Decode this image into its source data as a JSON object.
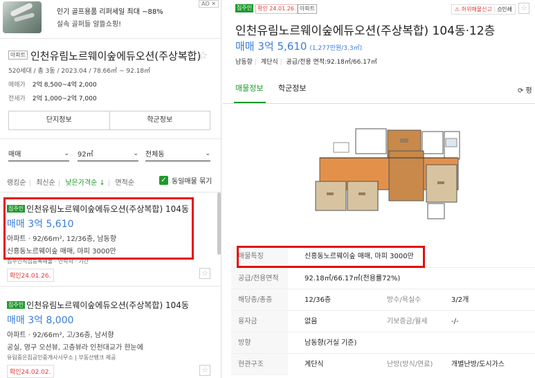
{
  "ad": {
    "title": "인기 골프용품 리퍼세일 최대 ~88%",
    "subtitle": "실속 골퍼들 알뜰쇼핑!",
    "badge": "AD ✕"
  },
  "complex": {
    "type_tag": "아파트",
    "name": "인천유림노르웨이숲에듀오션(주상복합)",
    "favorite_icon": "☆",
    "info": "520세대 / 총 3동 / 2023.04 / 78.66㎡ ~ 92.18㎡",
    "sale_label": "매매가",
    "sale_range": "2억 8,500~4억 2,000",
    "rent_label": "전세가",
    "rent_range": "2억 1,000~2억 7,000",
    "buttons": [
      "단지정보",
      "학군정보"
    ]
  },
  "filters": {
    "trade_type": "매매",
    "area": "92㎡",
    "building": "전체동",
    "chevron": "⌄"
  },
  "sort": {
    "options": [
      "랭킹순",
      "최신순",
      "낮은가격순 ↓",
      "면적순"
    ],
    "active_index": 2,
    "same_listing_label": "동일매물 묶기",
    "same_listing_checked": true
  },
  "listings": [
    {
      "badge": "집주인",
      "title": "인천유림노르웨이숲에듀오션(주상복합) 104동",
      "price": "매매 3억 5,610",
      "spec": "아파트 · 92/66m², 12/36층, 남동향",
      "desc": "신흥동노르웨이숲 매매, 마피 3000만",
      "agent": "집주인직접등록매물 · 연락처 · 기간",
      "confirm": "확인24.01.26.",
      "star": "☆"
    },
    {
      "badge": "집주인",
      "title": "인천유림노르웨이숲에듀오션(주상복합) 104동",
      "price": "매매 3억 8,000",
      "spec": "아파트 · 92/66m², 고/36층, 남서향",
      "desc": "공실, 영구 오션뷰, 고층뷰라 인천대교가 한눈에",
      "agent": "유림중은집공인중개사사무소 | 부동산뱅크 제공",
      "confirm": "확인24.02.02.",
      "star": "☆"
    }
  ],
  "detail": {
    "badges": [
      "집주인",
      "확인 24.01.26.",
      "아파트"
    ],
    "report": "허위매물신고",
    "print": "인쇄",
    "star": "☆",
    "title": "인천유림노르웨이숲에듀오션(주상복합) 104동·12층",
    "price": "매매 3억 5,610",
    "price_unit": "(1,277만원/3.3㎡)",
    "summary": [
      "남동향",
      "계단식",
      "공급/전용 면적:92.18㎡/66.17㎡"
    ],
    "tabs": [
      "매물정보",
      "학군정보"
    ],
    "side_button": "⟳ 평",
    "rows": [
      {
        "label": "매물특징",
        "value": "신흥동노르웨이숲 매매, 마피 3000만",
        "label2": "",
        "value2": ""
      },
      {
        "label": "공급/전용면적",
        "value": "92.18㎡/66.17㎡(전용률72%)",
        "label2": "",
        "value2": ""
      },
      {
        "label": "해당층/총층",
        "value": "12/36층",
        "label2": "방수/욕실수",
        "value2": "3/2개"
      },
      {
        "label": "융자금",
        "value": "없음",
        "label2": "기보증금/월세",
        "value2": "-/-"
      },
      {
        "label": "방향",
        "value": "남동향(거실 기준)",
        "label2": "",
        "value2": ""
      },
      {
        "label": "현관구조",
        "value": "계단식",
        "label2": "난방(방식/연료)",
        "value2": "개별난방/도시가스"
      }
    ]
  }
}
